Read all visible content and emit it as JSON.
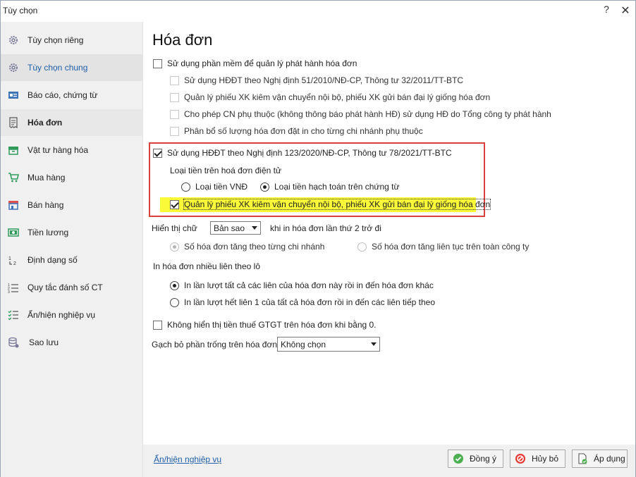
{
  "window": {
    "title": "Tùy chọn",
    "help": "?",
    "close": "✕"
  },
  "sidebar": {
    "items": [
      {
        "label": "Tùy chọn riêng",
        "icon": "gear-icon"
      },
      {
        "label": "Tùy chọn chung",
        "icon": "gear-icon"
      },
      {
        "label": "Báo cáo, chứng từ",
        "icon": "report-icon"
      },
      {
        "label": "Hóa đơn",
        "icon": "invoice-icon"
      },
      {
        "label": "Vật tư hàng hóa",
        "icon": "box-icon"
      },
      {
        "label": "Mua hàng",
        "icon": "cart-icon"
      },
      {
        "label": "Bán hàng",
        "icon": "store-icon"
      },
      {
        "label": "Tiền lương",
        "icon": "salary-icon"
      },
      {
        "label": "Định dạng số",
        "icon": "number-format-icon"
      },
      {
        "label": "Quy tắc đánh số CT",
        "icon": "numbering-icon"
      },
      {
        "label": "Ẩn/hiện nghiệp vụ",
        "icon": "show-hide-icon"
      },
      {
        "label": "Sao lưu",
        "icon": "database-icon"
      }
    ],
    "active_index": 3
  },
  "main": {
    "title": "Hóa đơn",
    "use_software": "Sử dụng phần mềm để quản lý phát hành hóa đơn",
    "sub_options": [
      "Sử dụng HĐĐT theo Nghị định 51/2010/NĐ-CP, Thông tư 32/2011/TT-BTC",
      "Quản lý phiếu XK kiêm vận chuyển nội bộ, phiếu XK gửi bán đại lý giống hóa đơn",
      "Cho phép CN phụ thuộc (không thông báo phát hành HĐ) sử dụng HĐ do Tổng công ty phát hành",
      "Phân bổ số lượng hóa đơn đặt in cho từng chi nhánh phụ thuộc"
    ],
    "use_decree_123": "Sử dụng HĐĐT theo Nghị định 123/2020/NĐ-CP, Thông tư 78/2021/TT-BTC",
    "currency_type_label": "Loại tiền trên hoá đơn điện tử",
    "currency_vnd": "Loại tiền VNĐ",
    "currency_accounting": "Loại tiền hạch toán trên chứng từ",
    "manage_export_slip": "Quản lý phiếu XK kiêm vận chuyển nội bộ, phiếu XK gửi bán đại lý giống hóa đơn",
    "display_text_label": "Hiển thị chữ",
    "display_text_value": "Bản sao",
    "display_text_suffix": "khi in hóa đơn lần thứ 2 trở đi",
    "inv_number_by_branch": "Số hóa đơn tăng theo từng chi nhánh",
    "inv_number_continuous": "Số hóa đơn tăng liên tục trên toàn công ty",
    "print_multi_label": "In hóa đơn nhiều liên theo lô",
    "print_option_1": "In lần lượt tất cả các liên của hóa đơn này rồi in đến hóa đơn khác",
    "print_option_2": "In lần lượt hết liên 1 của tất cả hóa đơn rồi in đến các liên tiếp theo",
    "hide_vat_zero": "Không hiển thị tiền thuế GTGT trên hóa đơn khi bằng 0.",
    "strike_blank_label": "Gạch bỏ phần trống trên hóa đơn",
    "strike_blank_value": "Không chọn"
  },
  "footer": {
    "link": "Ẩn/hiện nghiệp vụ",
    "ok": "Đồng ý",
    "cancel": "Hủy bỏ",
    "apply": "Áp dụng"
  },
  "colors": {
    "highlight": "#fafa38",
    "red_frame": "#d9413f",
    "link": "#1f5fa8"
  }
}
